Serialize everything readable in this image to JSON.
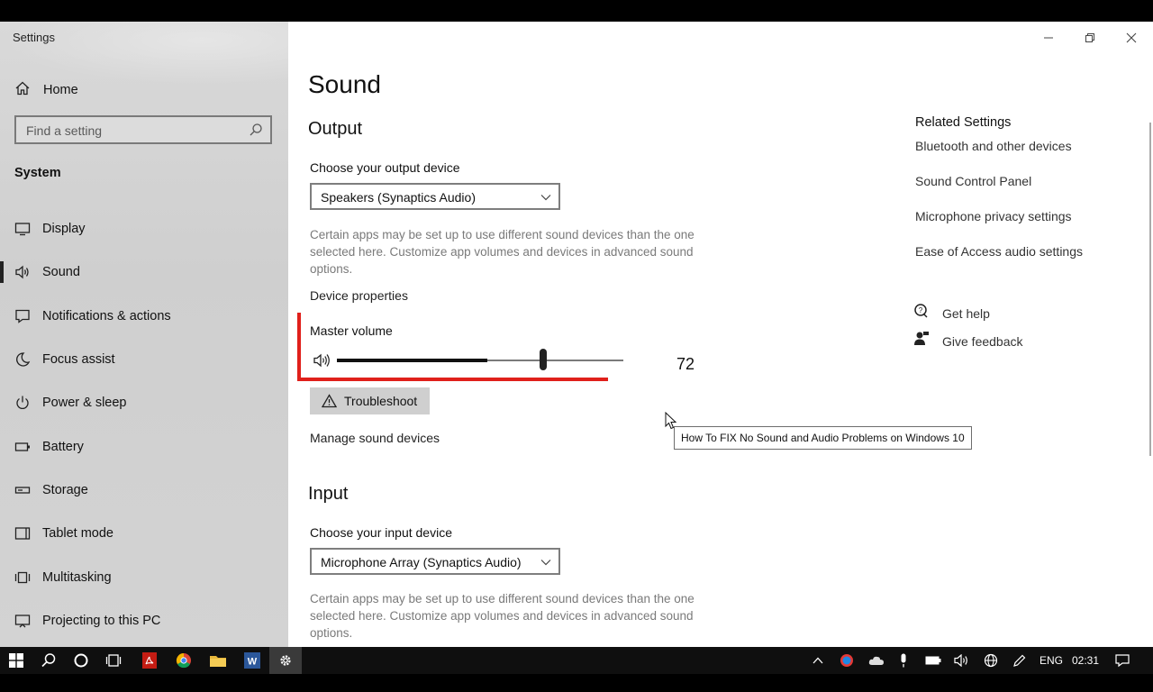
{
  "window": {
    "app_title": "Settings",
    "controls": [
      "minimize",
      "restore",
      "close"
    ]
  },
  "sidebar": {
    "home_label": "Home",
    "search_placeholder": "Find a setting",
    "section_title": "System",
    "items": [
      {
        "label": "Display",
        "icon": "display-icon"
      },
      {
        "label": "Sound",
        "icon": "speaker-icon",
        "active": true
      },
      {
        "label": "Notifications & actions",
        "icon": "notifications-icon"
      },
      {
        "label": "Focus assist",
        "icon": "moon-icon"
      },
      {
        "label": "Power & sleep",
        "icon": "power-icon"
      },
      {
        "label": "Battery",
        "icon": "battery-icon"
      },
      {
        "label": "Storage",
        "icon": "storage-icon"
      },
      {
        "label": "Tablet mode",
        "icon": "tablet-icon"
      },
      {
        "label": "Multitasking",
        "icon": "multitasking-icon"
      },
      {
        "label": "Projecting to this PC",
        "icon": "projecting-icon"
      }
    ]
  },
  "main": {
    "title": "Sound",
    "output": {
      "heading": "Output",
      "choose_label": "Choose your output device",
      "selected_device": "Speakers (Synaptics Audio)",
      "description": "Certain apps may be set up to use different sound devices than the one selected here. Customize app volumes and devices in advanced sound options.",
      "device_properties_link": "Device properties",
      "master_volume_label": "Master volume",
      "master_volume_value": "72",
      "master_volume_level": 0.72,
      "troubleshoot_label": "Troubleshoot",
      "manage_devices_link": "Manage sound devices"
    },
    "input": {
      "heading": "Input",
      "choose_label": "Choose your input device",
      "selected_device": "Microphone Array (Synaptics Audio)",
      "description": "Certain apps may be set up to use different sound devices than the one selected here. Customize app volumes and devices in advanced sound options."
    },
    "tooltip": "How To FIX No Sound and Audio Problems on Windows 10"
  },
  "related": {
    "heading": "Related Settings",
    "links": [
      "Bluetooth and other devices",
      "Sound Control Panel",
      "Microphone privacy settings",
      "Ease of Access audio settings"
    ],
    "get_help": "Get help",
    "give_feedback": "Give feedback"
  },
  "taskbar": {
    "language": "ENG",
    "time": "02:31",
    "pinned": [
      "windows-start-icon",
      "search-icon",
      "cortana-icon",
      "task-view-icon",
      "pdf-reader-icon",
      "chrome-icon",
      "file-explorer-icon",
      "word-icon",
      "settings-gear-icon"
    ]
  },
  "colors": {
    "sidebar_bg": "#d3d3d3",
    "annotation_red": "#e0201b",
    "taskbar_bg": "#0f0f0f"
  }
}
